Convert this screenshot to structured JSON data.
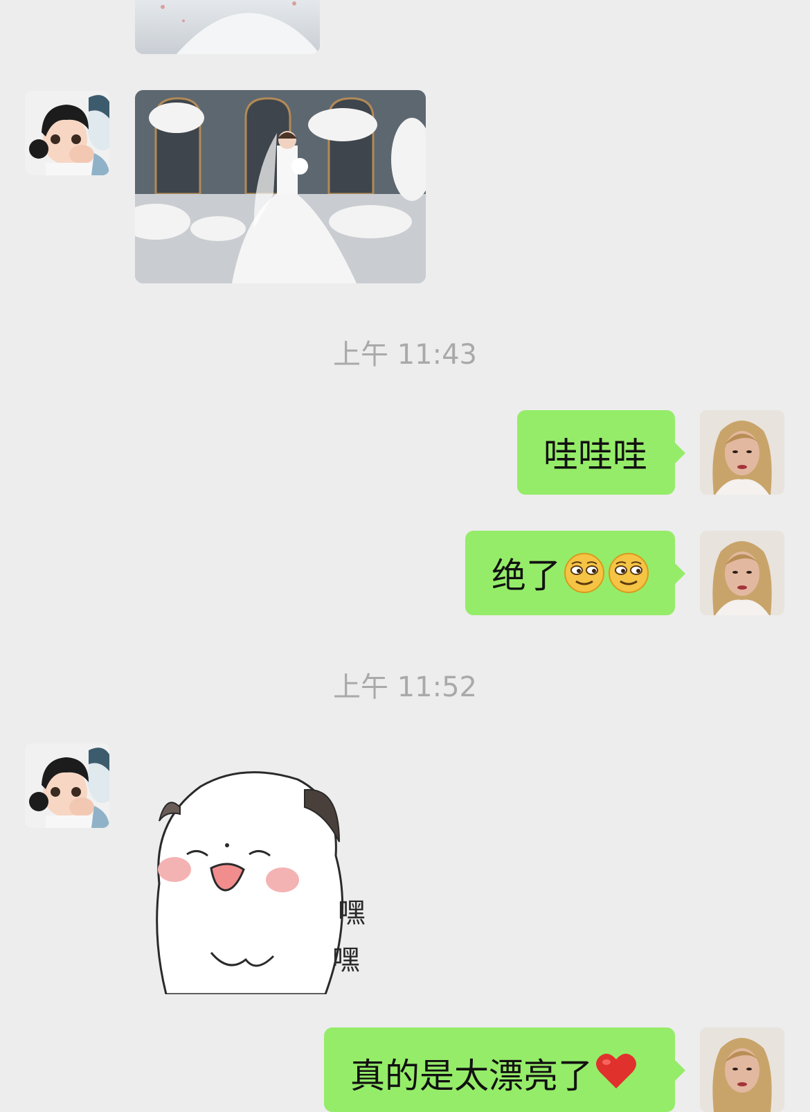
{
  "chat": {
    "timestamps": [
      "上午 11:43",
      "上午 11:52"
    ],
    "messages": {
      "wow": "哇哇哇",
      "amazing": "绝了",
      "beautiful": "真的是太漂亮了"
    },
    "sticker_text": [
      "嘿",
      "嘿"
    ]
  },
  "icons": {
    "contact_avatar": "cartoon-girl-avatar",
    "my_avatar": "woman-portrait-avatar",
    "smirk_emoji": "smirk-emoji",
    "heart_emoji": "red-heart-emoji"
  },
  "colors": {
    "background": "#ededed",
    "outgoing_bubble": "#95ec69",
    "timestamp_text": "#a9a9a9"
  }
}
